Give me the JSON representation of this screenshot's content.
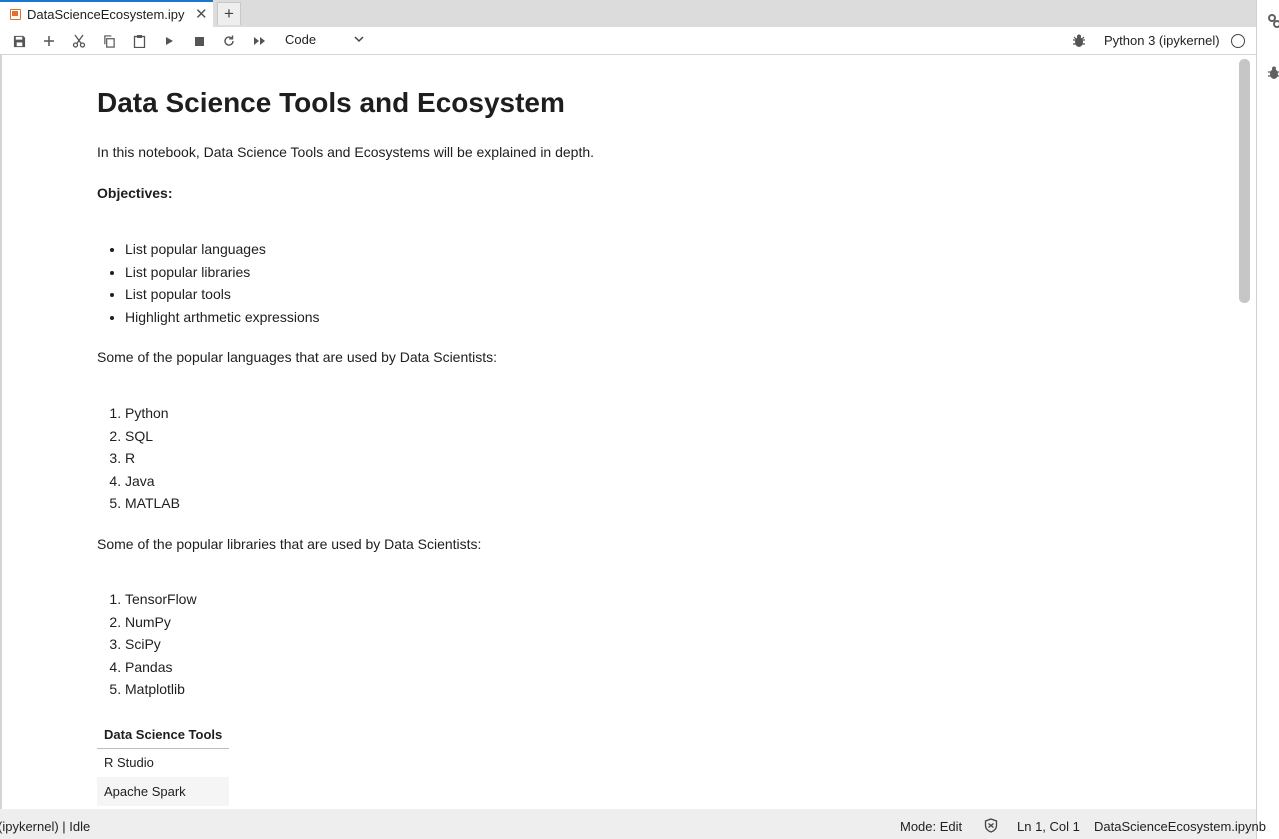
{
  "tab": {
    "title": "DataScienceEcosystem.ipy",
    "close_glyph": "✕",
    "new_tab_glyph": "+"
  },
  "toolbar": {
    "cell_type": "Code",
    "kernel_name": "Python 3 (ipykernel)",
    "icons": [
      "save-icon",
      "add-cell-icon",
      "cut-icon",
      "copy-icon",
      "paste-icon",
      "run-icon",
      "stop-icon",
      "restart-icon",
      "fast-forward-icon",
      "chevron-down-icon",
      "bug-icon",
      "kernel-status-icon"
    ]
  },
  "notebook": {
    "title": "Data Science Tools and Ecosystem",
    "intro": "In this notebook, Data Science Tools and Ecosystems will be explained in depth.",
    "objectives_label": "Objectives:",
    "objectives": [
      "List popular languages",
      "List popular libraries",
      "List popular tools",
      "Highlight arthmetic expressions"
    ],
    "languages_intro": "Some of the popular languages that are used by Data Scientists:",
    "languages": [
      "Python",
      "SQL",
      "R",
      "Java",
      "MATLAB"
    ],
    "libraries_intro": "Some of the popular libraries that are used by Data Scientists:",
    "libraries": [
      "TensorFlow",
      "NumPy",
      "SciPy",
      "Pandas",
      "Matplotlib"
    ],
    "tools_table": {
      "header": "Data Science Tools",
      "rows": [
        "R Studio",
        "Apache Spark"
      ]
    }
  },
  "statusbar": {
    "kernel_status": "(ipykernel) | Idle",
    "mode": "Mode: Edit",
    "position": "Ln 1, Col 1",
    "filename": "DataScienceEcosystem.ipynb"
  },
  "colors": {
    "accent": "#1976d2",
    "notebook_icon": "#e46e2e"
  }
}
